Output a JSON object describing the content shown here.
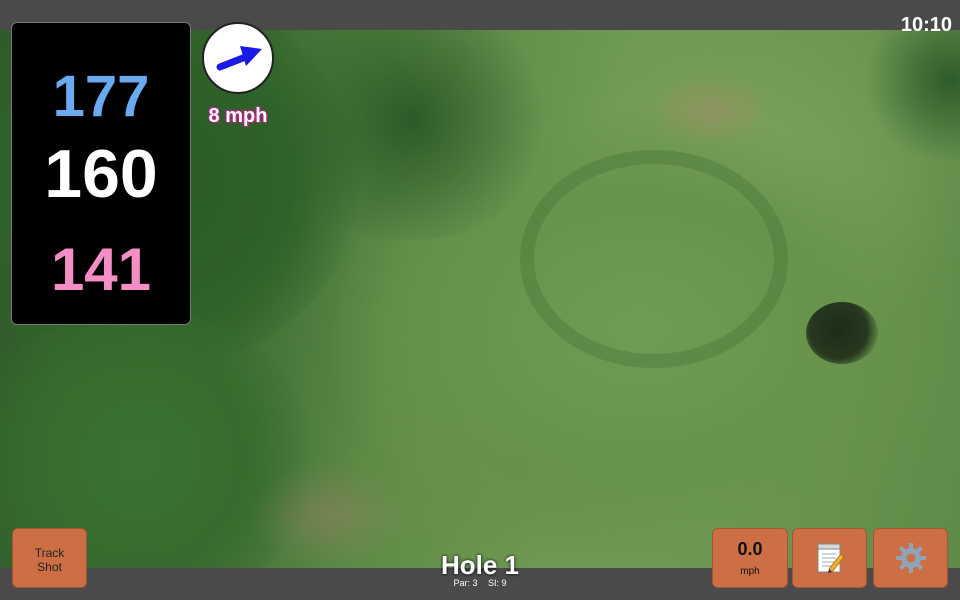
{
  "status_bar": {
    "time": "10:10"
  },
  "distances": {
    "back": "177",
    "middle": "160",
    "front": "141"
  },
  "wind": {
    "speed_label": "8 mph",
    "arrow_icon": "wind-direction-arrow-icon",
    "arrow_color": "#1a1ae6"
  },
  "buttons": {
    "track_shot": "Track\nShot",
    "speed_value": "0.0",
    "speed_unit": "mph",
    "notes_icon": "notepad-icon",
    "settings_icon": "gear-icon"
  },
  "hole": {
    "title": "Hole 1",
    "par_label": "Par: 3",
    "si_label": "SI: 9"
  },
  "colors": {
    "back_distance": "#6aaaf0",
    "middle_distance": "#ffffff",
    "front_distance": "#f58ec4",
    "button_bg": "#cd6f45"
  }
}
